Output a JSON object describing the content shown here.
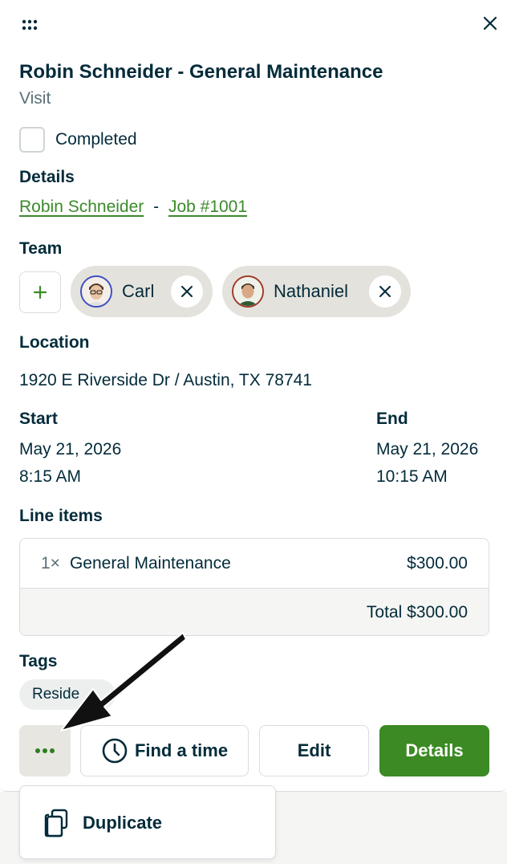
{
  "header": {
    "drag_icon": "grip-dots-icon",
    "close_icon": "close-x-icon"
  },
  "title": "Robin Schneider - General Maintenance",
  "subtitle": "Visit",
  "completed": {
    "label": "Completed",
    "checked": false
  },
  "details": {
    "heading": "Details",
    "client_link": "Robin Schneider",
    "separator": "-",
    "job_link": "Job #1001"
  },
  "team": {
    "heading": "Team",
    "add_icon": "plus-icon",
    "members": [
      {
        "name": "Carl"
      },
      {
        "name": "Nathaniel"
      }
    ]
  },
  "location": {
    "heading": "Location",
    "address": "1920 E Riverside Dr / Austin, TX 78741"
  },
  "schedule": {
    "start_heading": "Start",
    "start_date": "May 21, 2026",
    "start_time": "8:15 AM",
    "end_heading": "End",
    "end_date": "May 21, 2026",
    "end_time": "10:15 AM"
  },
  "line_items": {
    "heading": "Line items",
    "items": [
      {
        "qty": "1×",
        "name": "General Maintenance",
        "price": "$300.00"
      }
    ],
    "total": "Total $300.00"
  },
  "tags": {
    "heading": "Tags",
    "items": [
      "Reside"
    ]
  },
  "actions": {
    "more_icon": "more-dots-icon",
    "find_time_label": "Find a time",
    "edit_label": "Edit",
    "details_label": "Details"
  },
  "menu": {
    "items": [
      {
        "label": "Duplicate",
        "icon": "duplicate-icon"
      }
    ]
  },
  "colors": {
    "accent": "#3b8a24",
    "text": "#032b3a",
    "link": "#3a8a2a"
  }
}
